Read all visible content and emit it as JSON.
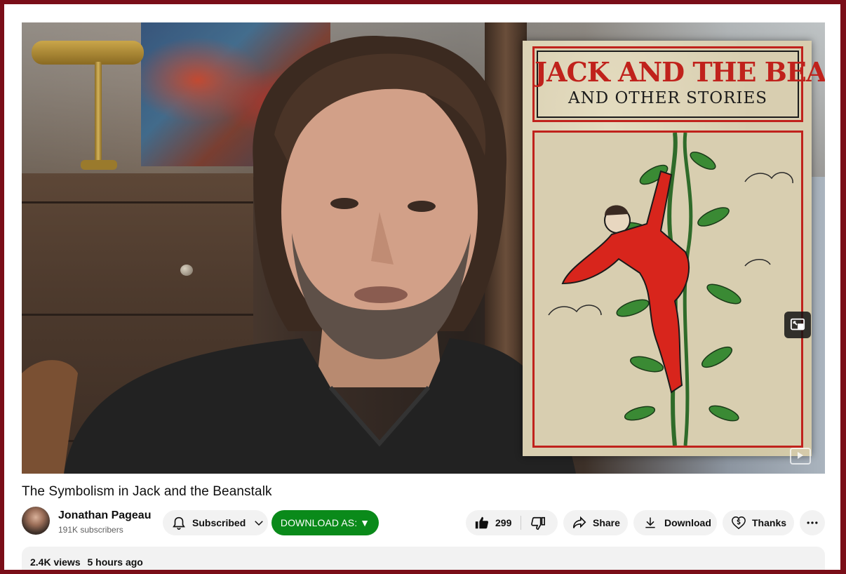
{
  "video": {
    "title": "The Symbolism in Jack and the Beanstalk",
    "book_title": "JACK AND THE BEANSTALK",
    "book_subtitle": "AND OTHER STORIES"
  },
  "channel": {
    "name": "Jonathan Pageau",
    "subscribers": "191K subscribers"
  },
  "actions": {
    "subscribed_label": "Subscribed",
    "download_as_label": "DOWNLOAD AS: ▼",
    "like_count": "299",
    "share_label": "Share",
    "download_label": "Download",
    "thanks_label": "Thanks"
  },
  "description": {
    "views": "2.4K views",
    "uploaded": "5 hours ago"
  },
  "colors": {
    "frame_border": "#7a0e18",
    "download_as_bg": "#0a8a1a",
    "pill_bg": "#f2f2f2",
    "book_red": "#c0221c"
  },
  "icons": {
    "subscribed": "bell-icon",
    "subscribed_menu": "chevron-down-icon",
    "like": "thumbs-up-icon",
    "dislike": "thumbs-down-icon",
    "share": "share-arrow-icon",
    "download": "download-icon",
    "thanks": "heart-dollar-icon",
    "more": "more-horizontal-icon",
    "miniplayer": "miniplayer-icon"
  }
}
